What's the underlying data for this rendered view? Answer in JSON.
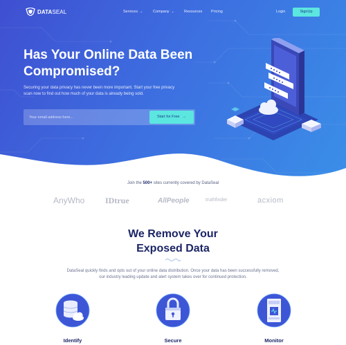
{
  "brand": {
    "name_bold": "DATA",
    "name_thin": "SEAL"
  },
  "nav": {
    "services": "Services",
    "company": "Company",
    "resources": "Resources",
    "pricing": "Pricing",
    "login": "Login",
    "signup": "SignUp"
  },
  "hero": {
    "title": "Has Your Online Data Been Compromised?",
    "subtitle": "Securing your data privacy has never been more important. Start your free privacy scan now to find out how much of your data is already being sold.",
    "email_placeholder": "Your email address here...",
    "cta": "Start for Free"
  },
  "clients": {
    "join_prefix": "Join the",
    "join_count": "500+",
    "join_suffix": "sites currently covered by DataSeal",
    "logos": [
      "AnyWho",
      "IDtrue",
      "AllPeople",
      "truthfinder",
      "acxiom"
    ]
  },
  "remove": {
    "title_line1": "We Remove Your",
    "title_line2": "Exposed Data",
    "description": "DataSeal quickly finds and opts out of your online data distribution. Once your data has been successfully removed, our industry leading update and alert system takes over for continued protection."
  },
  "features": [
    {
      "label": "Identify",
      "icon": "database-cloud-icon"
    },
    {
      "label": "Secure",
      "icon": "padlock-icon"
    },
    {
      "label": "Monitor",
      "icon": "server-monitor-icon"
    }
  ],
  "colors": {
    "accent": "#5ce6e0",
    "hero_start": "#3f4fd1",
    "hero_end": "#3a8fe8",
    "heading": "#1c2566"
  }
}
